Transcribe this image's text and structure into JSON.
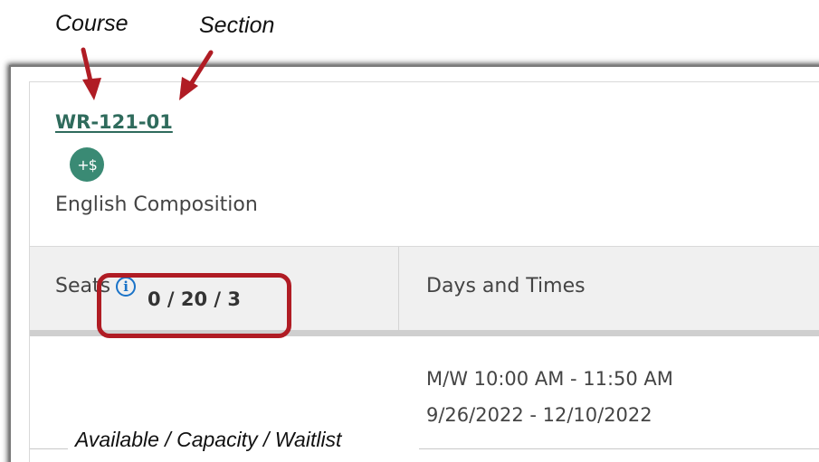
{
  "annotations": {
    "course": "Course",
    "section": "Section",
    "seats_legend": "Available / Capacity / Waitlist"
  },
  "section": {
    "link": "WR-121-01",
    "fee_badge": "+$",
    "title": "English Composition"
  },
  "table": {
    "headers": {
      "seats": "Seats",
      "info_glyph": "i",
      "days_times": "Days and Times"
    },
    "row": {
      "seats": "0 / 20 / 3",
      "meeting_time": "M/W 10:00 AM - 11:50 AM",
      "date_range": "9/26/2022 - 12/10/2022"
    }
  },
  "colors": {
    "annotation_red": "#b01c24",
    "link_green": "#2f6b5c",
    "badge_green": "#3a8a74",
    "info_blue": "#1a73c8"
  }
}
